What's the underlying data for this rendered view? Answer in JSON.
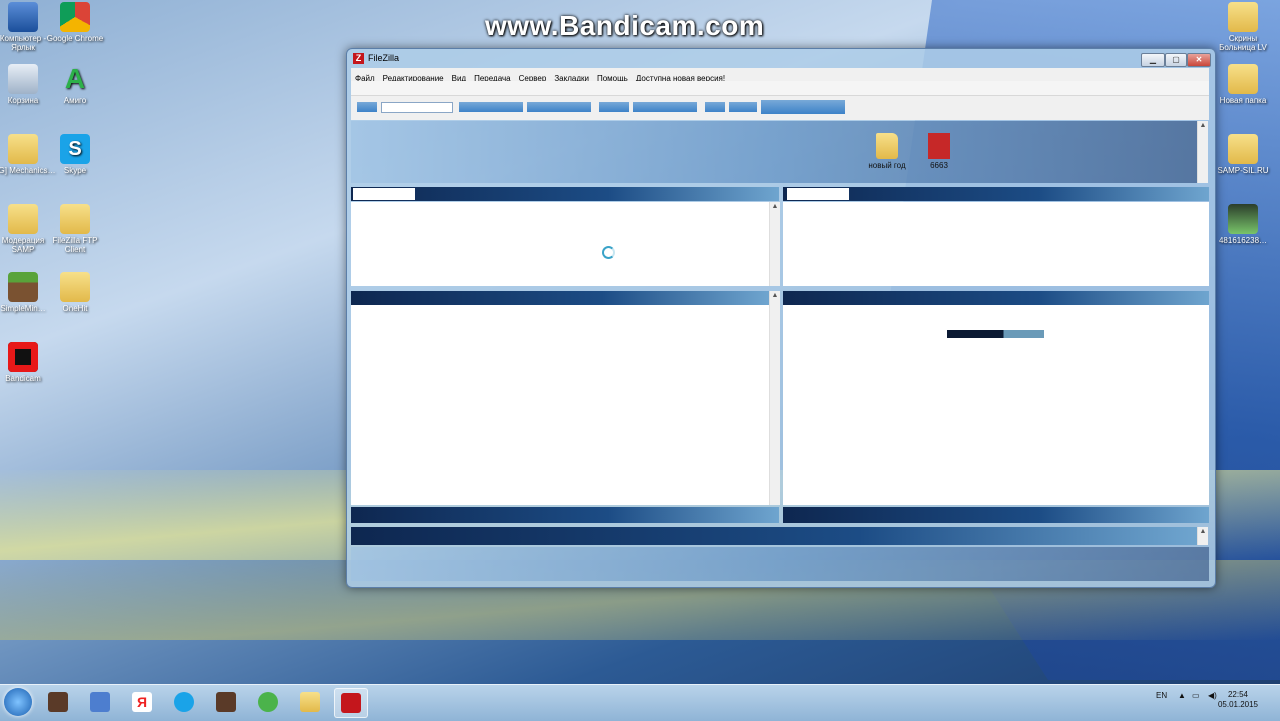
{
  "watermark": "www.Bandicam.com",
  "desktop_left": [
    {
      "label": "Компьютер - Ярлык",
      "icon": "computer-icon"
    },
    {
      "label": "Google Chrome",
      "icon": "chrome-icon"
    },
    {
      "label": "Корзина",
      "icon": "recycle-bin-icon"
    },
    {
      "label": "Амиго",
      "icon": "amigo-icon"
    },
    {
      "label": "[RG] Mechanics…",
      "icon": "folder-icon"
    },
    {
      "label": "Skype",
      "icon": "skype-icon"
    },
    {
      "label": "Модерация SAMP",
      "icon": "folder-icon"
    },
    {
      "label": "FileZilla FTP Client",
      "icon": "folder-icon"
    },
    {
      "label": "SimpleMin…",
      "icon": "minecraft-icon"
    },
    {
      "label": "OneHit",
      "icon": "folder-icon"
    },
    {
      "label": "Bandicam",
      "icon": "bandicam-icon"
    }
  ],
  "desktop_right": [
    {
      "label": "Скрины Больница LV",
      "icon": "folder-icon"
    },
    {
      "label": "Новая папка",
      "icon": "folder-icon"
    },
    {
      "label": "SAMP-SIL.RU",
      "icon": "folder-icon"
    },
    {
      "label": "481616238…",
      "icon": "eye-image-icon"
    }
  ],
  "window": {
    "title": "FileZilla",
    "menu": [
      "Файл",
      "Редактирование",
      "Вид",
      "Передача",
      "Сервер",
      "Закладки",
      "Помощь",
      "Доступна новая версия!"
    ],
    "buttons": {
      "minimize": "▁",
      "maximize": "▢",
      "close": "✕"
    }
  },
  "inner_icons": [
    {
      "label": "новый год",
      "icon": "folder-icon"
    },
    {
      "label": "6663",
      "icon": "image-icon"
    }
  ],
  "taskbar": {
    "lang": "EN",
    "time": "22:54",
    "date": "05.01.2015"
  }
}
